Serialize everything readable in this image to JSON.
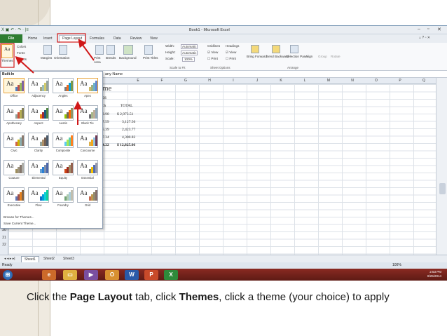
{
  "window": {
    "title": "Book1 - Microsoft Excel",
    "qat": "X ▣ ↶ · ↷ · |≡"
  },
  "tabs": [
    {
      "label": "File"
    },
    {
      "label": "Home"
    },
    {
      "label": "Insert"
    },
    {
      "label": "Page Layout",
      "active": true
    },
    {
      "label": "Formulas"
    },
    {
      "label": "Data"
    },
    {
      "label": "Review"
    },
    {
      "label": "View"
    }
  ],
  "ribbon": {
    "themes": {
      "themes": "Themes",
      "colors": "Colors",
      "fonts": "Fonts",
      "effects": "Effects"
    },
    "page_setup": {
      "margins": "Margins",
      "orientation": "Orientation",
      "print": "Print",
      "breaks": "Breaks",
      "background": "Background",
      "print_titles": "Print Titles",
      "area": "Area"
    },
    "scale": {
      "width": "Width:",
      "width_val": "Automatic",
      "height": "Height:",
      "height_val": "Automatic",
      "scale": "Scale:",
      "scale_val": "100%",
      "label": "Scale to Fit"
    },
    "sheet_options": {
      "gridlines": "Gridlines",
      "headings": "Headings",
      "view": "View",
      "print": "Print",
      "label": "Sheet Options"
    },
    "arrange": {
      "bring_forward": "Bring Forward",
      "send_backward": "Send Backward",
      "selection_pane": "Selection Pane",
      "align": "Align",
      "group": "Group",
      "rotate": "Rotate",
      "label": "Arrange"
    }
  },
  "formula_bar": {
    "value": "any Name"
  },
  "columns": [
    "E",
    "F",
    "G",
    "H",
    "I",
    "J",
    "K",
    "L",
    "M",
    "N",
    "O",
    "P",
    "Q",
    "R"
  ],
  "rows": [
    "16",
    "17",
    "18",
    "19",
    "20",
    "21",
    "22"
  ],
  "cells": {
    "title": "me",
    "subtitle": "es",
    "col_header_1": "ch",
    "col_header_2": "TOTAL",
    "values_1": [
      "3.90",
      "7.59",
      "5.39",
      "7.34",
      "4.22"
    ],
    "values_2": [
      "$ 2,973.51",
      "3,127.56",
      "2,423.77",
      "4,300.82",
      "$ 12,825.66"
    ]
  },
  "gallery": {
    "header": "Built-In",
    "themes": [
      {
        "name": "Office",
        "selected": true
      },
      {
        "name": "Adjacency"
      },
      {
        "name": "Angles"
      },
      {
        "name": "Apex",
        "hover": true
      },
      {
        "name": "Apothecary"
      },
      {
        "name": "Aspect"
      },
      {
        "name": "Austin"
      },
      {
        "name": "Black Tie"
      },
      {
        "name": "Civic"
      },
      {
        "name": "Clarity"
      },
      {
        "name": "Composite"
      },
      {
        "name": "Concourse"
      },
      {
        "name": "Couture"
      },
      {
        "name": "Elemental"
      },
      {
        "name": "Equity"
      },
      {
        "name": "Essential"
      },
      {
        "name": "Executive"
      },
      {
        "name": "Flow"
      },
      {
        "name": "Foundry"
      },
      {
        "name": "Grid"
      }
    ],
    "tooltip": "Apex",
    "browse": "Browse for Themes...",
    "save": "Save Current Theme..."
  },
  "sheets": {
    "nav": "◂ ◂ ▸ ▸|",
    "tabs": [
      "Sheet1",
      "Sheet2",
      "Sheet3"
    ],
    "active": "Sheet1"
  },
  "status": {
    "ready": "Ready",
    "zoom": "100%"
  },
  "taskbar": {
    "time": "2:53 PM",
    "date": "8/25/2014"
  },
  "caption": {
    "pre": "Click the ",
    "page_layout": "Page Layout",
    "mid1": " tab, click ",
    "themes": "Themes",
    "post": ", click a theme (your choice) to apply"
  }
}
